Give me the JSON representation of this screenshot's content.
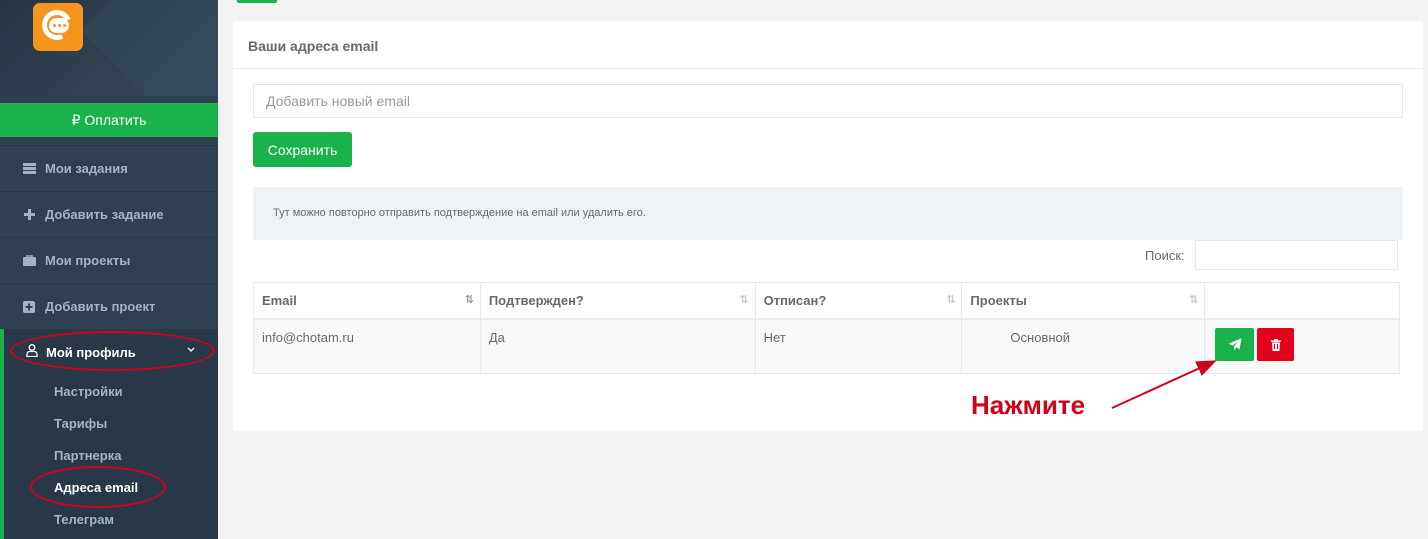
{
  "sidebar": {
    "pay_label": "₽ Оплатить",
    "items": [
      {
        "label": "Мои задания",
        "icon": "tasks-list-icon"
      },
      {
        "label": "Добавить задание",
        "icon": "plus-icon"
      },
      {
        "label": "Мои проекты",
        "icon": "briefcase-icon"
      },
      {
        "label": "Добавить проект",
        "icon": "plus-square-icon"
      }
    ],
    "profile": {
      "label": "Мой профиль",
      "icon": "user-icon",
      "chevron": "chevron-down-icon"
    },
    "subitems": [
      "Настройки",
      "Тарифы",
      "Партнерка",
      "Адреса email",
      "Телеграм"
    ]
  },
  "panel": {
    "title": "Ваши адреса email",
    "email_placeholder": "Добавить новый email",
    "save_label": "Сохранить",
    "info": "Тут можно повторно отправить подтверждение на email или удалить его.",
    "search_label": "Поиск:"
  },
  "table": {
    "headers": [
      "Email",
      "Подтвержден?",
      "Отписан?",
      "Проекты",
      ""
    ],
    "rows": [
      {
        "email": "info@chotam.ru",
        "confirmed": "Да",
        "unsubscribed": "Нет",
        "projects": "Основной"
      }
    ]
  },
  "annotation": {
    "label": "Нажмите"
  },
  "colors": {
    "accent": "#1ab34b",
    "danger": "#e3001b",
    "sidebar": "#2f4050",
    "logo": "#f7941e",
    "annotation": "#d0021b"
  }
}
